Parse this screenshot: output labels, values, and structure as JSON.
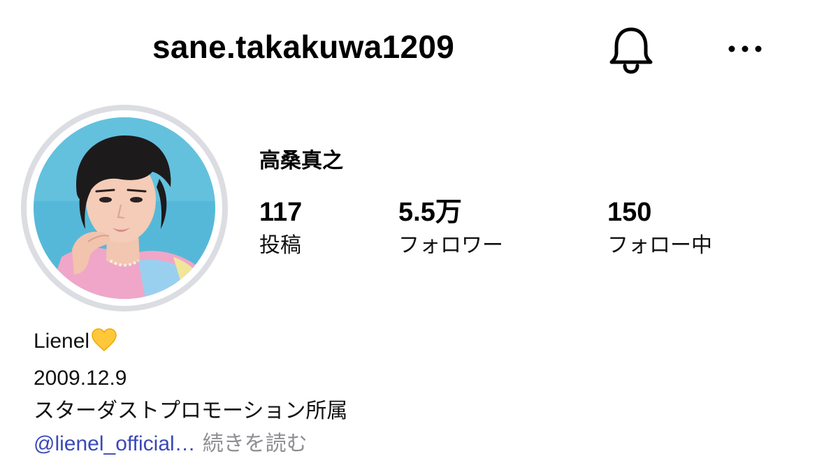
{
  "header": {
    "username": "sane.takakuwa1209",
    "notification_icon": "bell-icon",
    "more_icon": "more-options-icon"
  },
  "profile": {
    "display_name": "高桑真之",
    "avatar_description_icon": "profile-photo",
    "stats": [
      {
        "value": "117",
        "label": "投稿"
      },
      {
        "value": "5.5万",
        "label": "フォロワー"
      },
      {
        "value": "150",
        "label": "フォロー中"
      }
    ]
  },
  "bio": {
    "line1": "Lienel",
    "line1_emoji": "yellow-heart-icon",
    "line2": "2009.12.9",
    "line3": "スターダストプロモーション所属",
    "mention": "@lienel_official…",
    "read_more": "続きを読む"
  },
  "colors": {
    "mention": "#3a49b8",
    "muted": "#8e8e93",
    "ring": "#dbdde2",
    "avatar_bg": "#56b8d8"
  }
}
